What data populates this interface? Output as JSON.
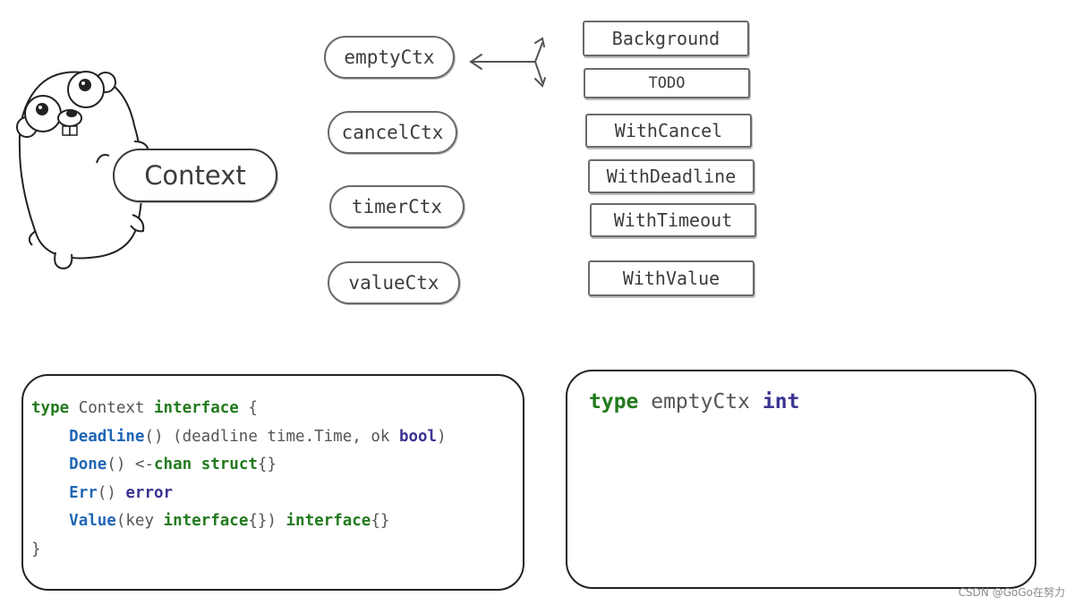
{
  "mascot": {
    "label": "Context"
  },
  "types": [
    {
      "label": "emptyCtx"
    },
    {
      "label": "cancelCtx"
    },
    {
      "label": "timerCtx"
    },
    {
      "label": "valueCtx"
    }
  ],
  "functions": [
    {
      "label": "Background"
    },
    {
      "label": "TODO"
    },
    {
      "label": "WithCancel"
    },
    {
      "label": "WithDeadline"
    },
    {
      "label": "WithTimeout"
    },
    {
      "label": "WithValue"
    }
  ],
  "interface_code": {
    "line1": {
      "kw_type": "type",
      "name": " Context ",
      "kw_interface": "interface",
      "brace": " {"
    },
    "line2": {
      "fn": "Deadline",
      "args": "() (deadline time.Time, ok ",
      "ret": "bool",
      "close": ")"
    },
    "line3": {
      "fn": "Done",
      "args": "() <-",
      "kw_chan": "chan",
      "sp": " ",
      "kw_struct": "struct",
      "brace": "{}"
    },
    "line4": {
      "fn": "Err",
      "args": "() ",
      "ret": "error"
    },
    "line5": {
      "fn": "Value",
      "p1": "(key ",
      "kw_iface1": "interface",
      "p2": "{}) ",
      "kw_iface2": "interface",
      "p3": "{}"
    },
    "line6": {
      "brace": "}"
    }
  },
  "empty_code": {
    "kw_type": "type",
    "name": " emptyCtx ",
    "ret": "int"
  },
  "watermark": "CSDN @GoGo在努力",
  "colors": {
    "keyword": "#237a1e",
    "function": "#2166b5",
    "type": "#3b3392",
    "border": "#222222"
  }
}
